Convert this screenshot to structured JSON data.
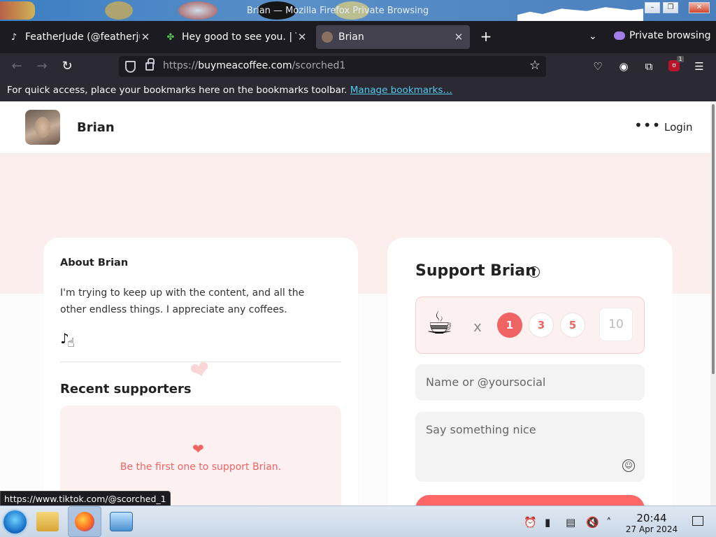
{
  "window": {
    "title": "Brian — Mozilla Firefox Private Browsing",
    "controls": [
      "–",
      "❐",
      "✕"
    ]
  },
  "tabs": [
    {
      "label": "FeatherJude (@featherjude",
      "icon": "tiktok-icon"
    },
    {
      "label": "Hey good to see you. | Ti",
      "icon": "clover-icon"
    },
    {
      "label": "Brian",
      "icon": "avatar-icon",
      "active": true
    }
  ],
  "browser": {
    "private_label": "Private browsing",
    "url_prefix": "https://",
    "url_domain": "buymeacoffee.com",
    "url_path": "/scorched1",
    "extension_badge": "1"
  },
  "bookmarks_bar": {
    "text": "For quick access, place your bookmarks here on the bookmarks toolbar.",
    "link": "Manage bookmarks…"
  },
  "site": {
    "creator_name": "Brian",
    "login_label": "Login",
    "about": {
      "title": "About Brian",
      "text": "I'm trying to keep up with the content, and all the other endless things.  I appreciate any coffees."
    },
    "recent": {
      "title": "Recent supporters",
      "empty_text": "Be the first one to support Brian."
    },
    "support": {
      "title": "Support Brian",
      "times": "x",
      "quantities": [
        "1",
        "3",
        "5"
      ],
      "custom_quantity_placeholder": "10",
      "selected_quantity": "1",
      "name_placeholder": "Name or @yoursocial",
      "message_placeholder": "Say something nice"
    }
  },
  "status_url": "https://www.tiktok.com/@scorched_1",
  "taskbar": {
    "time": "20:44",
    "date": "27 Apr 2024"
  },
  "colors": {
    "accent": "#f06464",
    "page_band": "#fdeeee",
    "browser_chrome": "#2b2a33"
  }
}
